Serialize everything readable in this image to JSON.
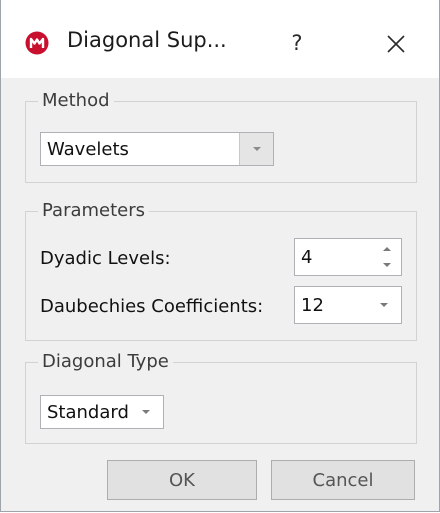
{
  "window": {
    "title": "Diagonal Sup...",
    "help_label": "?",
    "icon": "matlab-logo-icon",
    "close_icon": "close-icon"
  },
  "method": {
    "legend": "Method",
    "selected": "Wavelets"
  },
  "parameters": {
    "legend": "Parameters",
    "dyadic_levels_label": "Dyadic Levels:",
    "dyadic_levels_value": "4",
    "daubechies_label": "Daubechies Coefficients:",
    "daubechies_value": "12"
  },
  "diagonal_type": {
    "legend": "Diagonal Type",
    "selected": "Standard"
  },
  "buttons": {
    "ok": "OK",
    "cancel": "Cancel"
  },
  "colors": {
    "brand": "#c8102e",
    "window_bg": "#f0f0f0",
    "titlebar_bg": "#ffffff"
  }
}
